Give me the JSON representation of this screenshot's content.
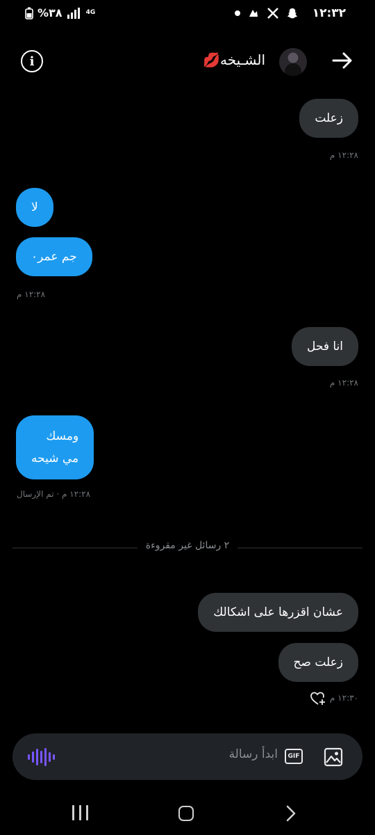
{
  "status_bar": {
    "time": "١٢:٣٢",
    "battery": "%٣٨",
    "network": "4G",
    "icons_left": [
      "battery-icon",
      "signal-icon"
    ],
    "icons_right": [
      "snapchat-icon",
      "x-icon",
      "notification-icon",
      "dot-icon"
    ]
  },
  "header": {
    "contact_name": "الشـيخه💋",
    "back_icon": "arrow-right-icon",
    "info_icon": "info-icon",
    "info_glyph": "i"
  },
  "messages": [
    {
      "direction": "outgoing",
      "text": "زعلت"
    },
    {
      "meta": "١٢:٢٨ م"
    },
    {
      "direction": "incoming",
      "text": "لا"
    },
    {
      "direction": "incoming",
      "text": "جم عمر٠"
    },
    {
      "meta": "١٢:٢٨ م"
    },
    {
      "direction": "outgoing",
      "text": "انا فحل"
    },
    {
      "meta": "١٢:٢٨ م"
    },
    {
      "direction": "incoming",
      "line1": "ومسك",
      "line2": "مي شيحه"
    },
    {
      "meta": "١٢:٢٨ م · تم الإرسال"
    },
    {
      "direction": "outgoing",
      "text": "عشان اقزرها على اشكالك"
    },
    {
      "direction": "outgoing",
      "text": "زعلت صح"
    },
    {
      "meta": "١٢:٣٠ م"
    }
  ],
  "unread_divider": "٢ رسائل غير مقروءة",
  "composer": {
    "placeholder": "ابدأ رسالة",
    "gif_label": "GIF",
    "voice_icon": "voice-waveform-icon",
    "image_icon": "image-icon"
  },
  "colors": {
    "accent": "#1d9bf0",
    "outgoing_bubble": "#2f3336",
    "voice": "#7856ff",
    "meta_text": "#71767b"
  },
  "nav_bar": [
    "recent-apps-icon",
    "home-icon",
    "back-icon"
  ]
}
